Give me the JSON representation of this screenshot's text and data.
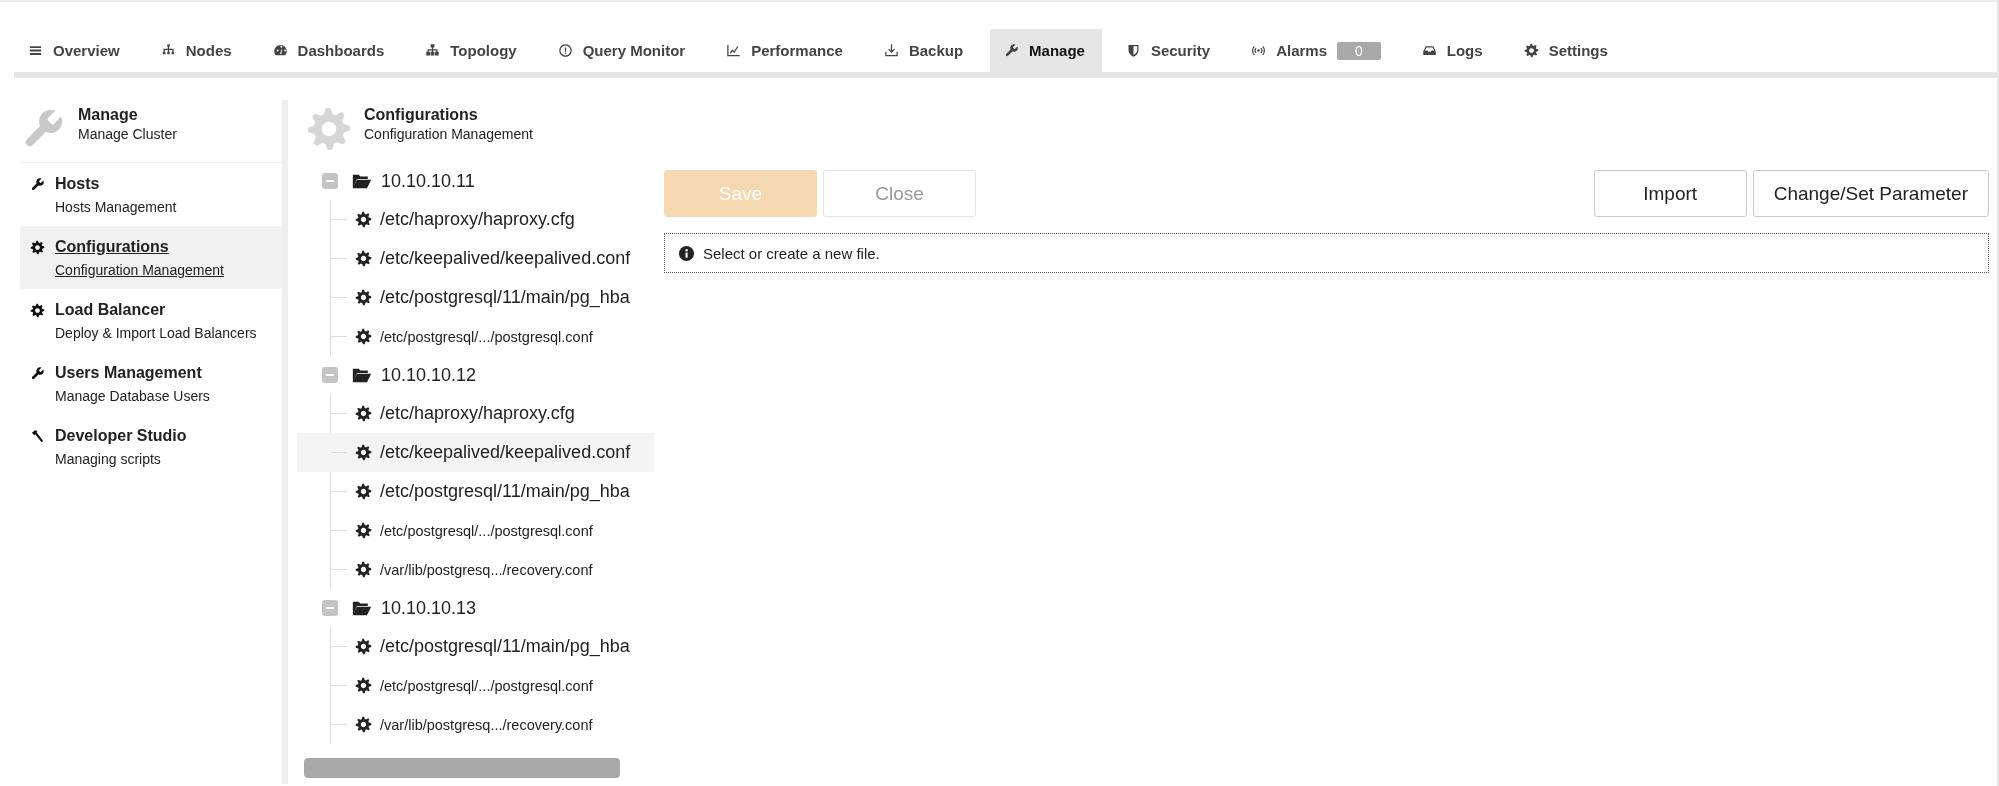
{
  "tabs": [
    {
      "label": "Overview",
      "selected": false
    },
    {
      "label": "Nodes",
      "selected": false
    },
    {
      "label": "Dashboards",
      "selected": false
    },
    {
      "label": "Topology",
      "selected": false
    },
    {
      "label": "Query Monitor",
      "selected": false
    },
    {
      "label": "Performance",
      "selected": false
    },
    {
      "label": "Backup",
      "selected": false
    },
    {
      "label": "Manage",
      "selected": true
    },
    {
      "label": "Security",
      "selected": false
    },
    {
      "label": "Alarms",
      "selected": false,
      "badge": "0"
    },
    {
      "label": "Logs",
      "selected": false
    },
    {
      "label": "Settings",
      "selected": false
    }
  ],
  "sidebar": {
    "title": "Manage",
    "subtitle": "Manage Cluster",
    "items": [
      {
        "title": "Hosts",
        "subtitle": "Hosts Management",
        "selected": false
      },
      {
        "title": "Configurations",
        "subtitle": "Configuration Management",
        "selected": true
      },
      {
        "title": "Load Balancer",
        "subtitle": "Deploy & Import Load Balancers",
        "selected": false
      },
      {
        "title": "Users Management",
        "subtitle": "Manage Database Users",
        "selected": false
      },
      {
        "title": "Developer Studio",
        "subtitle": "Managing scripts",
        "selected": false
      }
    ]
  },
  "tree": {
    "title": "Configurations",
    "subtitle": "Configuration Management",
    "hosts": [
      {
        "label": "10.10.10.11",
        "expanded": true,
        "children": [
          {
            "label": "/etc/haproxy/haproxy.cfg",
            "kind": "full",
            "selected": false
          },
          {
            "label": "/etc/keepalived/keepalived.conf",
            "kind": "full",
            "selected": false
          },
          {
            "label": "/etc/postgresql/11/main/pg_hba",
            "kind": "full",
            "selected": false
          },
          {
            "label": "/etc/postgresql/.../postgresql.conf",
            "kind": "short",
            "selected": false
          }
        ]
      },
      {
        "label": "10.10.10.12",
        "expanded": true,
        "children": [
          {
            "label": "/etc/haproxy/haproxy.cfg",
            "kind": "full",
            "selected": false
          },
          {
            "label": "/etc/keepalived/keepalived.conf",
            "kind": "full",
            "selected": true
          },
          {
            "label": "/etc/postgresql/11/main/pg_hba",
            "kind": "full",
            "selected": false
          },
          {
            "label": "/etc/postgresql/.../postgresql.conf",
            "kind": "short",
            "selected": false
          },
          {
            "label": "/var/lib/postgresq.../recovery.conf",
            "kind": "short",
            "selected": false
          }
        ]
      },
      {
        "label": "10.10.10.13",
        "expanded": true,
        "children": [
          {
            "label": "/etc/postgresql/11/main/pg_hba",
            "kind": "full",
            "selected": false
          },
          {
            "label": "/etc/postgresql/.../postgresql.conf",
            "kind": "short",
            "selected": false
          },
          {
            "label": "/var/lib/postgresq.../recovery.conf",
            "kind": "short",
            "selected": false
          }
        ]
      }
    ]
  },
  "toolbar": {
    "left": [
      {
        "label": "Save",
        "disabled": true
      },
      {
        "label": "Close",
        "disabled": true
      }
    ],
    "right": [
      {
        "label": "Import",
        "disabled": false
      },
      {
        "label": "Change/Set Parameter",
        "disabled": false
      }
    ]
  },
  "notice": "Select or create a new file."
}
